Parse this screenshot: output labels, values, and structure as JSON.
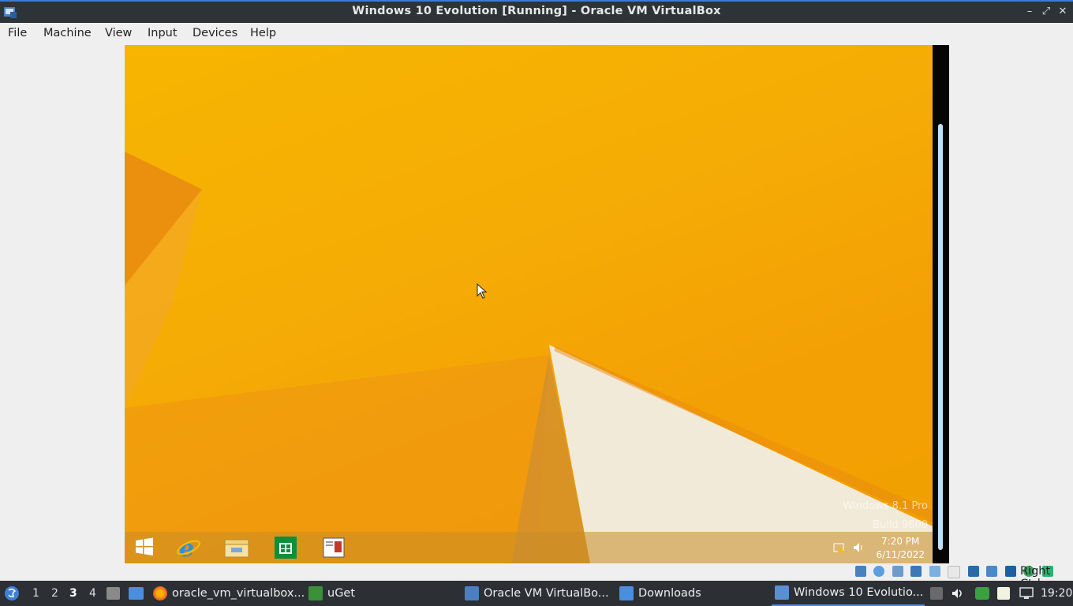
{
  "window": {
    "title": "Windows 10 Evolution [Running] - Oracle VM VirtualBox",
    "controls": [
      "minimize",
      "maximize",
      "close"
    ]
  },
  "menubar": {
    "items": [
      "File",
      "Machine",
      "View",
      "Input",
      "Devices",
      "Help"
    ]
  },
  "vm": {
    "watermark_line1": "Windows 8.1 Pro",
    "watermark_line2": "Build 9600",
    "clock_time": "7:20 PM",
    "clock_date": "6/11/2022",
    "taskbar_icons": [
      "windows-start-icon",
      "internet-explorer-icon",
      "file-explorer-icon",
      "store-icon",
      "reader-icon"
    ]
  },
  "statusbar": {
    "host_key": "Right Ctrl",
    "icons": [
      "hard-disk-icon",
      "optical-drive-icon",
      "audio-icon",
      "network-icon",
      "usb-icon",
      "shared-folders-icon",
      "display-icon",
      "video-capture-icon",
      "virtualization-icon",
      "mouse-integration-icon",
      "additions-icon"
    ]
  },
  "panel": {
    "workspaces": [
      "1",
      "2",
      "3",
      "4"
    ],
    "active_workspace": "3",
    "tasks": [
      {
        "label": "oracle_vm_virtualbox...",
        "icon": "firefox-icon"
      },
      {
        "label": "uGet",
        "icon": "uget-icon"
      },
      {
        "label": "Oracle VM VirtualBo...",
        "icon": "virtualbox-icon"
      },
      {
        "label": "Downloads",
        "icon": "folder-icon"
      },
      {
        "label": "Windows 10 Evolutio...",
        "icon": "virtualbox-vm-icon"
      }
    ],
    "clock": "19:20",
    "colors": {
      "accent": "#4a8ee0",
      "panel_bg": "#2c3035"
    }
  }
}
